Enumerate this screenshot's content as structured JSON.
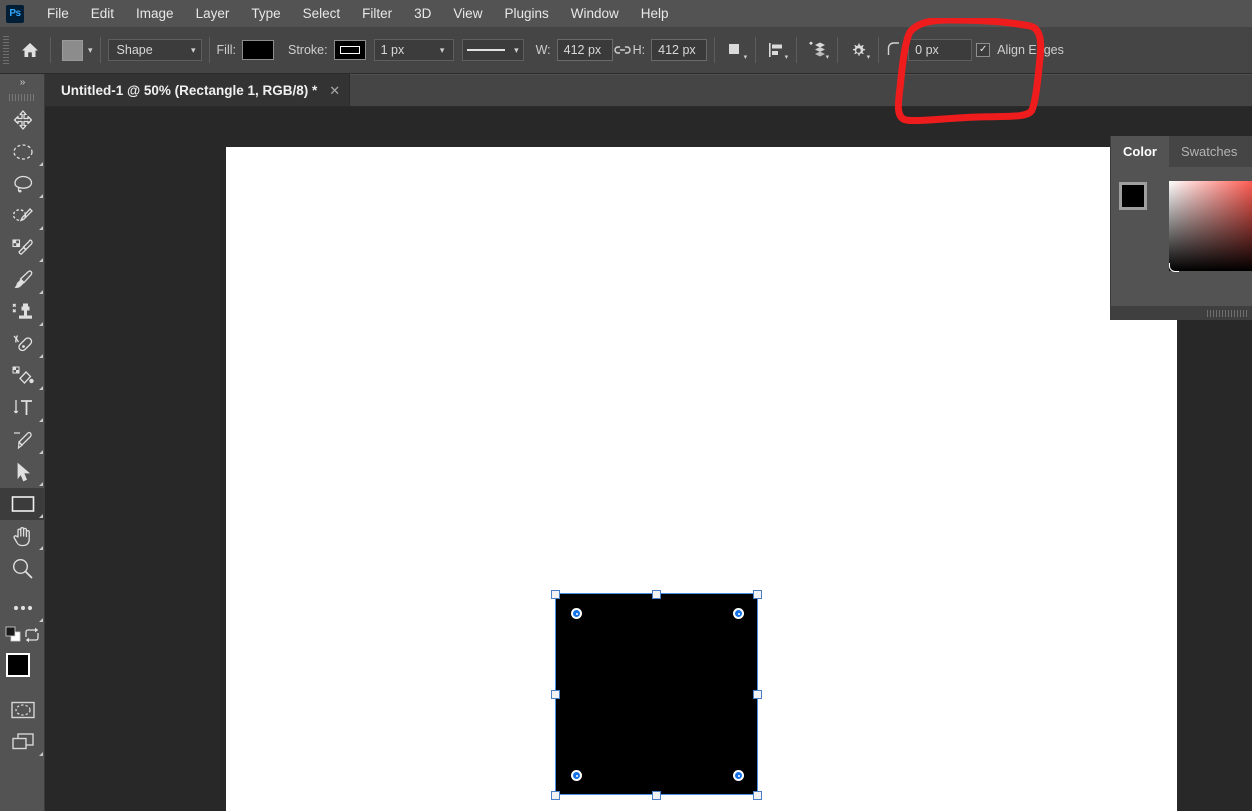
{
  "app": {
    "name": "Adobe Photoshop",
    "logo_text": "Ps"
  },
  "menubar": {
    "items": [
      {
        "label": "File"
      },
      {
        "label": "Edit"
      },
      {
        "label": "Image"
      },
      {
        "label": "Layer"
      },
      {
        "label": "Type"
      },
      {
        "label": "Select"
      },
      {
        "label": "Filter"
      },
      {
        "label": "3D"
      },
      {
        "label": "View"
      },
      {
        "label": "Plugins"
      },
      {
        "label": "Window"
      },
      {
        "label": "Help"
      }
    ]
  },
  "options_bar": {
    "home_icon": "home-icon",
    "tool_preset_label": "tool-preset-picker",
    "shape_mode": "Shape",
    "fill_label": "Fill:",
    "fill_color": "#000000",
    "stroke_label": "Stroke:",
    "stroke_color": "#000000",
    "stroke_width": "1 px",
    "stroke_style": "solid-line",
    "width_label": "W:",
    "width_value": "412 px",
    "link_icon": "link-dimensions-icon",
    "height_label": "H:",
    "height_value": "412 px",
    "path_operations_icon": "path-operations-icon",
    "path_alignment_icon": "path-alignment-icon",
    "path_arrangement_icon": "path-arrangement-icon",
    "settings_icon": "gear-icon",
    "radius_icon": "corner-radius-icon",
    "radius_value": "0 px",
    "align_edges_label": "Align Edges",
    "align_edges_checked": true
  },
  "tab_bar": {
    "tabs": [
      {
        "title": "Untitled-1 @ 50% (Rectangle 1, RGB/8) *",
        "close_glyph": "✕",
        "active": true
      }
    ]
  },
  "toolbar": {
    "collapse_glyph": "»",
    "tools": [
      {
        "name": "move-tool",
        "icon": "move-arrows-icon",
        "has_submenu": false,
        "active": false
      },
      {
        "name": "elliptical-marquee-tool",
        "icon": "dashed-ellipse-icon",
        "has_submenu": true,
        "active": false
      },
      {
        "name": "lasso-tool",
        "icon": "lasso-icon",
        "has_submenu": true,
        "active": false
      },
      {
        "name": "object-selection-tool",
        "icon": "quick-selection-icon",
        "has_submenu": true,
        "active": false
      },
      {
        "name": "eyedropper-tool",
        "icon": "eyedropper-icon",
        "has_submenu": true,
        "active": false
      },
      {
        "name": "brush-tool",
        "icon": "paintbrush-icon",
        "has_submenu": true,
        "active": false
      },
      {
        "name": "clone-stamp-tool",
        "icon": "clone-stamp-icon",
        "has_submenu": true,
        "active": false
      },
      {
        "name": "eraser-tool",
        "icon": "eraser-icon",
        "has_submenu": true,
        "active": false
      },
      {
        "name": "gradient-tool",
        "icon": "paint-bucket-icon",
        "has_submenu": true,
        "active": false
      },
      {
        "name": "type-tool",
        "icon": "vertical-type-icon",
        "has_submenu": true,
        "active": false
      },
      {
        "name": "pen-tool",
        "icon": "pen-icon",
        "has_submenu": true,
        "active": false
      },
      {
        "name": "path-selection-tool",
        "icon": "black-arrow-icon",
        "has_submenu": true,
        "active": false
      },
      {
        "name": "rectangle-tool",
        "icon": "rectangle-icon",
        "has_submenu": true,
        "active": true
      },
      {
        "name": "hand-tool",
        "icon": "hand-icon",
        "has_submenu": true,
        "active": false
      },
      {
        "name": "zoom-tool",
        "icon": "magnifier-icon",
        "has_submenu": false,
        "active": false
      },
      {
        "name": "edit-toolbar",
        "icon": "ellipsis-icon",
        "has_submenu": true,
        "active": false
      }
    ],
    "default_colors_icon": "default-foreground-background-icon",
    "swap_colors_icon": "swap-colors-icon",
    "foreground_color": "#000000",
    "background_color": "#ffffff",
    "quick_mask_icon": "quick-mask-icon",
    "screen_mode_icon": "screen-mode-icon"
  },
  "canvas": {
    "background_color": "#ffffff",
    "workspace_color": "#282828",
    "selection": {
      "shape": "rectangle",
      "fill_color": "#000000",
      "selection_outline_color": "#4a90e8",
      "handle_count": 8,
      "radius_widget_count": 4
    }
  },
  "color_panel": {
    "tabs": [
      {
        "label": "Color",
        "active": true
      },
      {
        "label": "Swatches",
        "active": false
      }
    ],
    "foreground_color": "#000000",
    "background_color": "#ffffff",
    "ramp_hue": "#ff3b30"
  },
  "annotation": {
    "type": "hand-drawn-highlight",
    "color": "#ee1c1c",
    "target": "corner-radius-field"
  }
}
